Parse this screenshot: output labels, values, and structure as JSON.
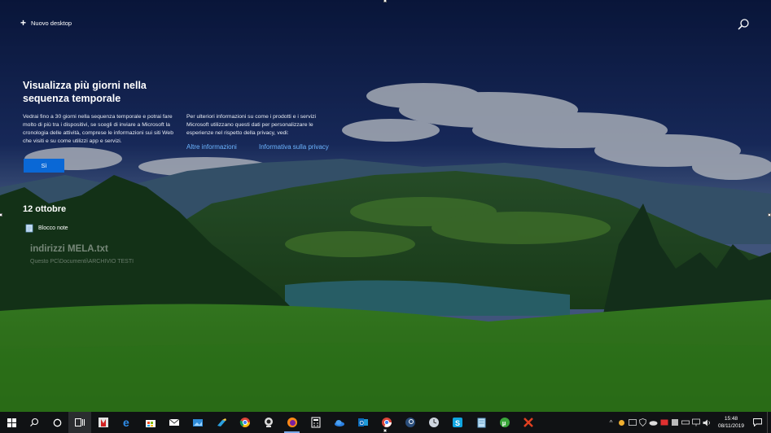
{
  "timeline": {
    "new_desktop_label": "Nuovo desktop",
    "promo": {
      "title": "Visualizza più giorni nella sequenza temporale",
      "text": "Vedrai fino a 30 giorni nella sequenza temporale e potrai fare molto di più tra i dispositivi, se scegli di inviare a Microsoft la cronologia delle attività, comprese le informazioni sui siti Web che visiti e su come utilizzi app e servizi.",
      "privacy_text": "Per ulteriori informazioni su come i prodotti e i servizi Microsoft utilizzano questi dati per personalizzare le esperienze nel rispetto della privacy, vedi:",
      "link_more": "Altre informazioni",
      "link_privacy": "Informativa sulla privacy",
      "yes_label": "Sì"
    },
    "date_heading": "12 ottobre",
    "activity": {
      "app_name": "Blocco note",
      "file_title": "indirizzi MELA.txt",
      "file_path": "Questo PC\\Documenti\\ARCHIVIO TESTI"
    }
  },
  "taskbar": {
    "start_icon": "windows-logo-icon",
    "apps": [
      "bookmark-app-icon",
      "edge-icon",
      "store-icon",
      "mail-icon",
      "photos-icon",
      "paint-3d-icon",
      "chrome-icon",
      "webcam-icon",
      "firefox-icon",
      "calculator-icon",
      "onedrive-icon",
      "outlook-icon",
      "chrome-alt-icon",
      "steam-icon",
      "clock-app-icon",
      "skype-icon",
      "notepad-icon",
      "utorrent-icon",
      "ccleaner-icon"
    ],
    "clock": {
      "time": "15:48",
      "date": "08/11/2019"
    }
  },
  "colors": {
    "accent": "#0a68d6",
    "link": "#6cb4ff",
    "taskbar": "#101214"
  }
}
